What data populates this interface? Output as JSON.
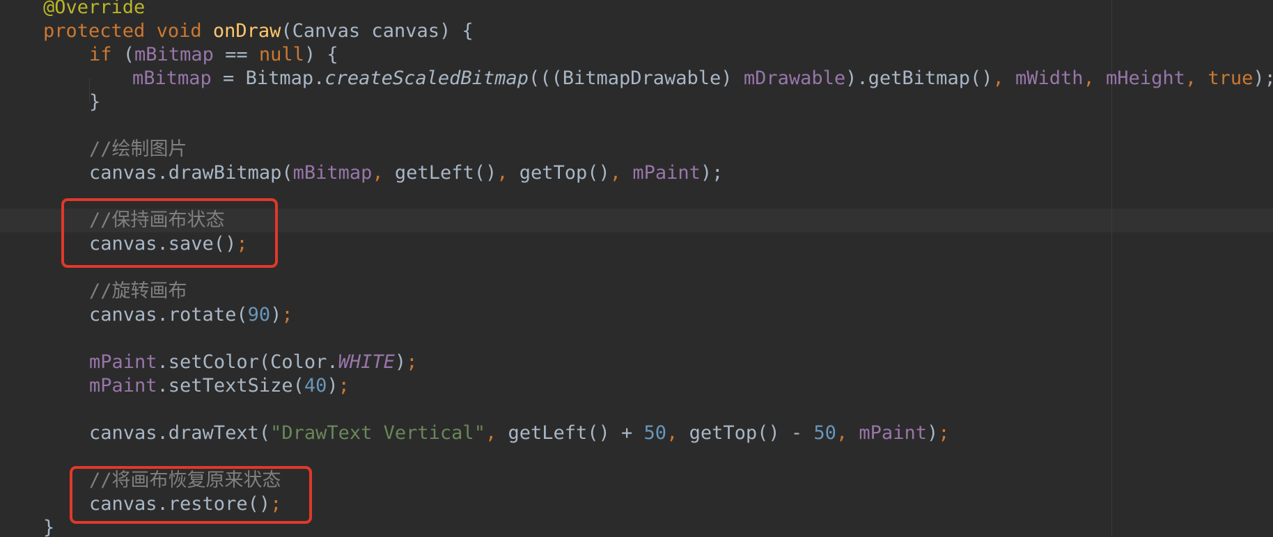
{
  "editor": {
    "colors": {
      "background": "#2b2b2b",
      "current_line": "#323232",
      "default_text": "#a9b7c6",
      "keyword": "#cc7832",
      "annotation": "#bbb529",
      "method_declaration": "#ffc66d",
      "field": "#9876aa",
      "number": "#6897bb",
      "string": "#6a8759",
      "comment": "#808080",
      "highlight_box": "#e0392b"
    },
    "lines": [
      {
        "tokens": [
          {
            "t": "@Override",
            "c": "annotation"
          }
        ]
      },
      {
        "tokens": [
          {
            "t": "protected ",
            "c": "keyword"
          },
          {
            "t": "void ",
            "c": "keyword"
          },
          {
            "t": "onDraw",
            "c": "method-decl"
          },
          {
            "t": "(Canvas canvas) {",
            "c": "plain"
          }
        ]
      },
      {
        "tokens": [
          {
            "t": "if ",
            "c": "keyword"
          },
          {
            "t": "(",
            "c": "plain"
          },
          {
            "t": "mBitmap",
            "c": "field"
          },
          {
            "t": " == ",
            "c": "plain"
          },
          {
            "t": "null",
            "c": "keyword"
          },
          {
            "t": ") {",
            "c": "plain"
          }
        ]
      },
      {
        "tokens": [
          {
            "t": "mBitmap",
            "c": "field"
          },
          {
            "t": " = Bitmap.",
            "c": "plain"
          },
          {
            "t": "createScaledBitmap",
            "c": "italic"
          },
          {
            "t": "(((BitmapDrawable) ",
            "c": "plain"
          },
          {
            "t": "mDrawable",
            "c": "field"
          },
          {
            "t": ").getBitmap()",
            "c": "plain"
          },
          {
            "t": ", ",
            "c": "punct"
          },
          {
            "t": "mWidth",
            "c": "field"
          },
          {
            "t": ", ",
            "c": "punct"
          },
          {
            "t": "mHeight",
            "c": "field"
          },
          {
            "t": ", ",
            "c": "punct"
          },
          {
            "t": "true",
            "c": "keyword"
          },
          {
            "t": ");",
            "c": "plain"
          }
        ]
      },
      {
        "tokens": [
          {
            "t": "}",
            "c": "plain"
          }
        ]
      },
      {
        "tokens": []
      },
      {
        "tokens": [
          {
            "t": "//绘制图片",
            "c": "comment"
          }
        ]
      },
      {
        "tokens": [
          {
            "t": "canvas.drawBitmap(",
            "c": "plain"
          },
          {
            "t": "mBitmap",
            "c": "field"
          },
          {
            "t": ", ",
            "c": "punct"
          },
          {
            "t": "getLeft()",
            "c": "plain"
          },
          {
            "t": ", ",
            "c": "punct"
          },
          {
            "t": "getTop()",
            "c": "plain"
          },
          {
            "t": ", ",
            "c": "punct"
          },
          {
            "t": "mPaint",
            "c": "field"
          },
          {
            "t": ");",
            "c": "plain"
          }
        ]
      },
      {
        "tokens": []
      },
      {
        "tokens": [
          {
            "t": "//保持画布状态",
            "c": "comment"
          }
        ]
      },
      {
        "tokens": [
          {
            "t": "canvas.save()",
            "c": "plain"
          },
          {
            "t": ";",
            "c": "punct"
          }
        ]
      },
      {
        "tokens": []
      },
      {
        "tokens": [
          {
            "t": "//旋转画布",
            "c": "comment"
          }
        ]
      },
      {
        "tokens": [
          {
            "t": "canvas.rotate(",
            "c": "plain"
          },
          {
            "t": "90",
            "c": "number"
          },
          {
            "t": ")",
            "c": "plain"
          },
          {
            "t": ";",
            "c": "punct"
          }
        ]
      },
      {
        "tokens": []
      },
      {
        "tokens": [
          {
            "t": "mPaint",
            "c": "field"
          },
          {
            "t": ".setColor(Color.",
            "c": "plain"
          },
          {
            "t": "WHITE",
            "c": "static"
          },
          {
            "t": ")",
            "c": "plain"
          },
          {
            "t": ";",
            "c": "punct"
          }
        ]
      },
      {
        "tokens": [
          {
            "t": "mPaint",
            "c": "field"
          },
          {
            "t": ".setTextSize(",
            "c": "plain"
          },
          {
            "t": "40",
            "c": "number"
          },
          {
            "t": ")",
            "c": "plain"
          },
          {
            "t": ";",
            "c": "punct"
          }
        ]
      },
      {
        "tokens": []
      },
      {
        "tokens": [
          {
            "t": "canvas.drawText(",
            "c": "plain"
          },
          {
            "t": "\"DrawText Vertical\"",
            "c": "string"
          },
          {
            "t": ", ",
            "c": "punct"
          },
          {
            "t": "getLeft() + ",
            "c": "plain"
          },
          {
            "t": "50",
            "c": "number"
          },
          {
            "t": ", ",
            "c": "punct"
          },
          {
            "t": "getTop() - ",
            "c": "plain"
          },
          {
            "t": "50",
            "c": "number"
          },
          {
            "t": ", ",
            "c": "punct"
          },
          {
            "t": "mPaint",
            "c": "field"
          },
          {
            "t": ")",
            "c": "plain"
          },
          {
            "t": ";",
            "c": "punct"
          }
        ]
      },
      {
        "tokens": []
      },
      {
        "tokens": [
          {
            "t": "//将画布恢复原来状态",
            "c": "comment"
          }
        ]
      },
      {
        "tokens": [
          {
            "t": "canvas.restore()",
            "c": "plain"
          },
          {
            "t": ";",
            "c": "punct"
          }
        ]
      },
      {
        "tokens": [
          {
            "t": "}",
            "c": "plain"
          }
        ]
      }
    ]
  }
}
